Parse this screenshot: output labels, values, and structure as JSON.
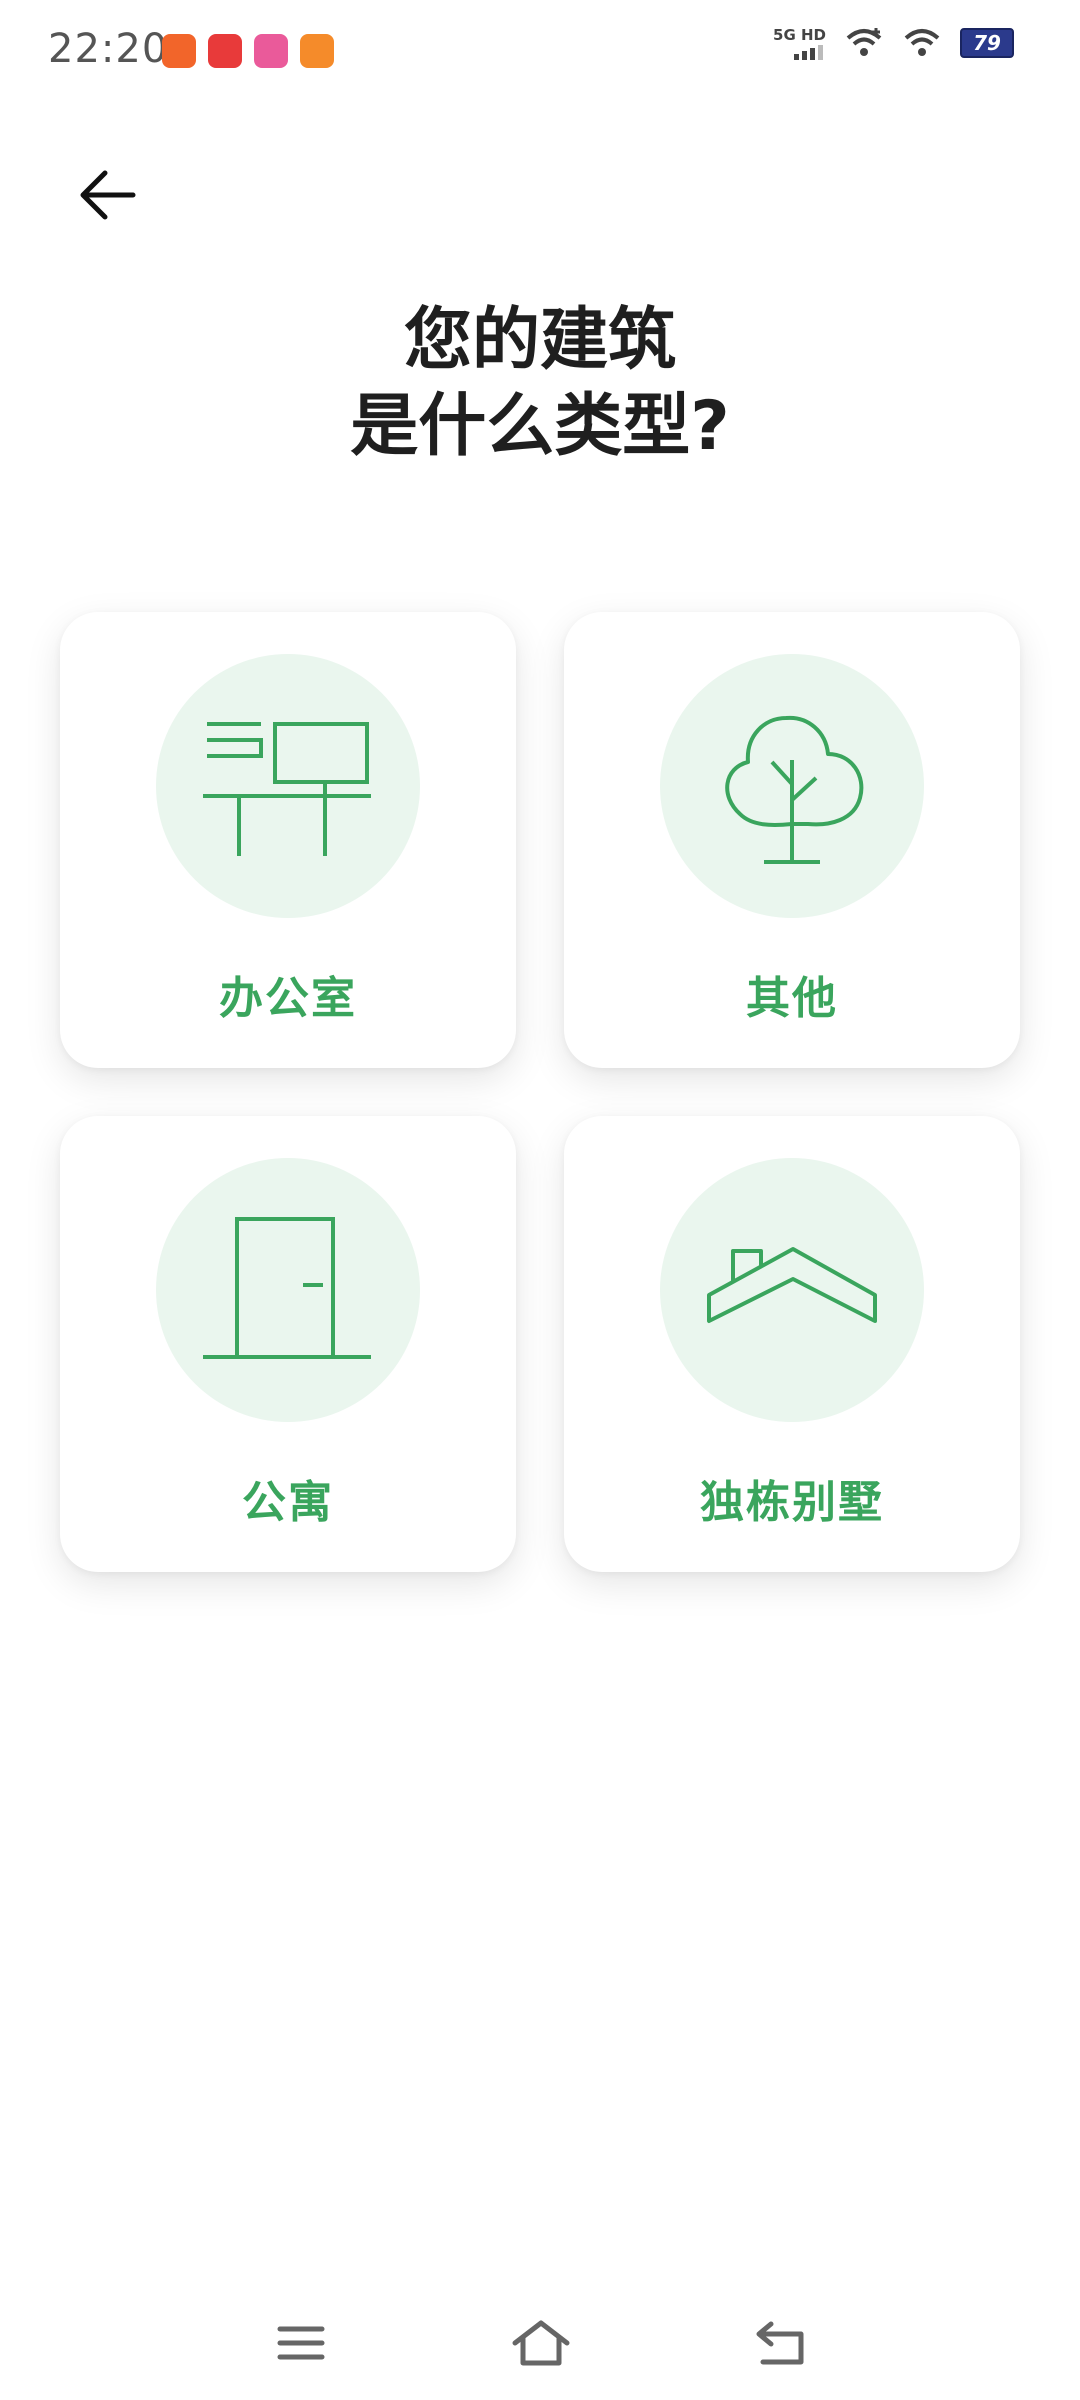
{
  "status_bar": {
    "time": "22:20",
    "network_top": "5G HD",
    "battery": "79",
    "notification_icons": [
      "app-icon-orange",
      "app-icon-red",
      "app-icon-pink",
      "app-icon-orange2"
    ]
  },
  "header": {
    "back_icon": "arrow-left-icon"
  },
  "title": {
    "line1": "您的建筑",
    "line2": "是什么类型?"
  },
  "options": [
    {
      "label": "办公室",
      "icon": "desk-icon"
    },
    {
      "label": "其他",
      "icon": "tree-icon"
    },
    {
      "label": "公寓",
      "icon": "door-icon"
    },
    {
      "label": "独栋别墅",
      "icon": "house-roof-icon"
    }
  ],
  "nav": {
    "menu_icon": "menu-icon",
    "home_icon": "home-icon",
    "back_icon": "back-icon"
  },
  "colors": {
    "accent": "#3aa55d",
    "circle_bg": "#eaf6ee",
    "title": "#1f1f1f"
  }
}
